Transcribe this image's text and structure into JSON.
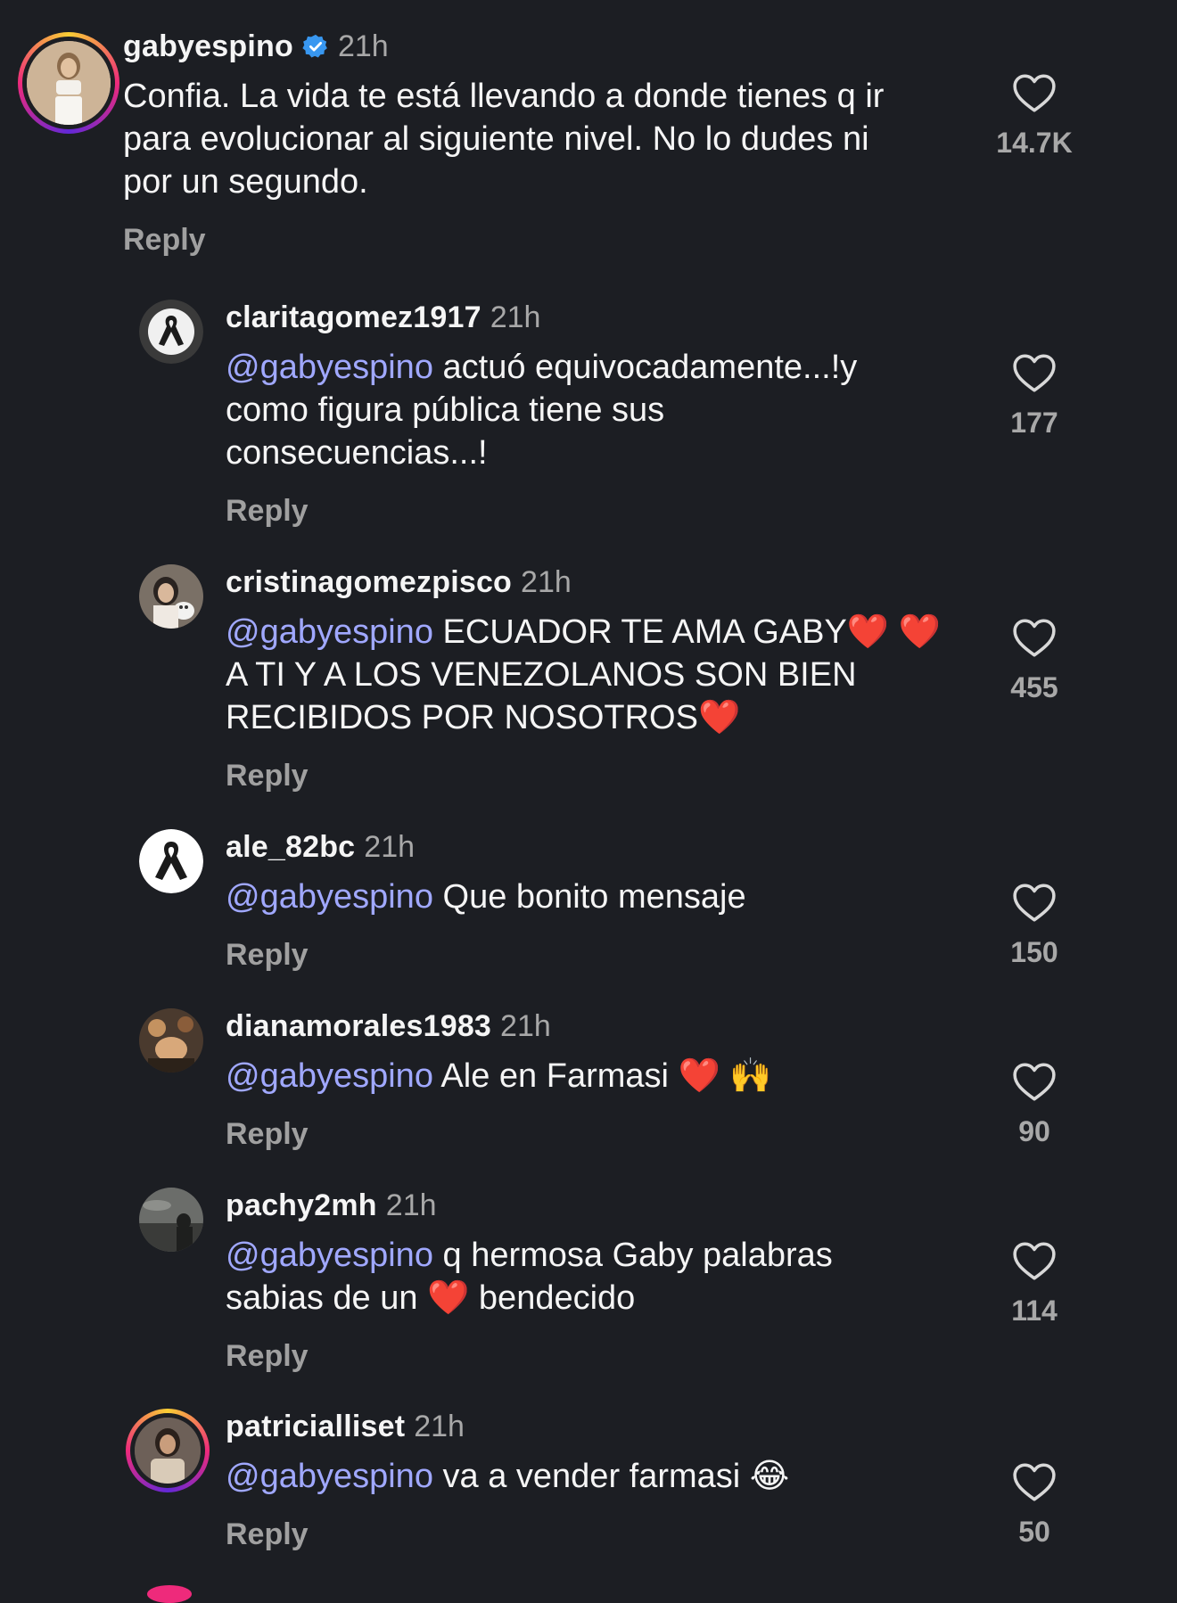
{
  "colors": {
    "background": "#1c1e23",
    "mention": "#a0a8ff",
    "secondary_text": "#a8a8a8",
    "verified_badge": "#3897f0",
    "story_ring": "#ee2a7b"
  },
  "comments": [
    {
      "username": "gabyespino",
      "verified": true,
      "time": "21h",
      "mention": "",
      "text": "Confia. La vida te está llevando a donde tienes q ir\npara evolucionar al siguiente nivel. No lo dudes ni\npor un segundo.",
      "reply_label": "Reply",
      "likes": "14.7K",
      "avatar_icon": "profile-photo"
    },
    {
      "username": "claritagomez1917",
      "verified": false,
      "time": "21h",
      "mention": "@gabyespino",
      "text": " actuó equivocadamente...!y\ncomo figura pública tiene sus\nconsecuencias...!",
      "reply_label": "Reply",
      "likes": "177",
      "avatar_icon": "black-ribbon-icon"
    },
    {
      "username": "cristinagomezpisco",
      "verified": false,
      "time": "21h",
      "mention": "@gabyespino",
      "text": " ECUADOR TE AMA GABY❤️ ❤️\nA TI Y A LOS VENEZOLANOS SON BIEN\nRECIBIDOS POR NOSOTROS❤️",
      "reply_label": "Reply",
      "likes": "455",
      "avatar_icon": "profile-photo"
    },
    {
      "username": "ale_82bc",
      "verified": false,
      "time": "21h",
      "mention": "@gabyespino",
      "text": " Que bonito mensaje",
      "reply_label": "Reply",
      "likes": "150",
      "avatar_icon": "black-ribbon-icon"
    },
    {
      "username": "dianamorales1983",
      "verified": false,
      "time": "21h",
      "mention": "@gabyespino",
      "text": " Ale en Farmasi ❤️ 🙌",
      "reply_label": "Reply",
      "likes": "90",
      "avatar_icon": "profile-photo"
    },
    {
      "username": "pachy2mh",
      "verified": false,
      "time": "21h",
      "mention": "@gabyespino",
      "text": " q hermosa Gaby palabras\nsabias de un ❤️ bendecido",
      "reply_label": "Reply",
      "likes": "114",
      "avatar_icon": "profile-photo"
    },
    {
      "username": "patricialliset",
      "verified": false,
      "time": "21h",
      "mention": "@gabyespino",
      "text": " va a vender farmasi 😂",
      "reply_label": "Reply",
      "likes": "50",
      "avatar_icon": "profile-photo"
    }
  ]
}
